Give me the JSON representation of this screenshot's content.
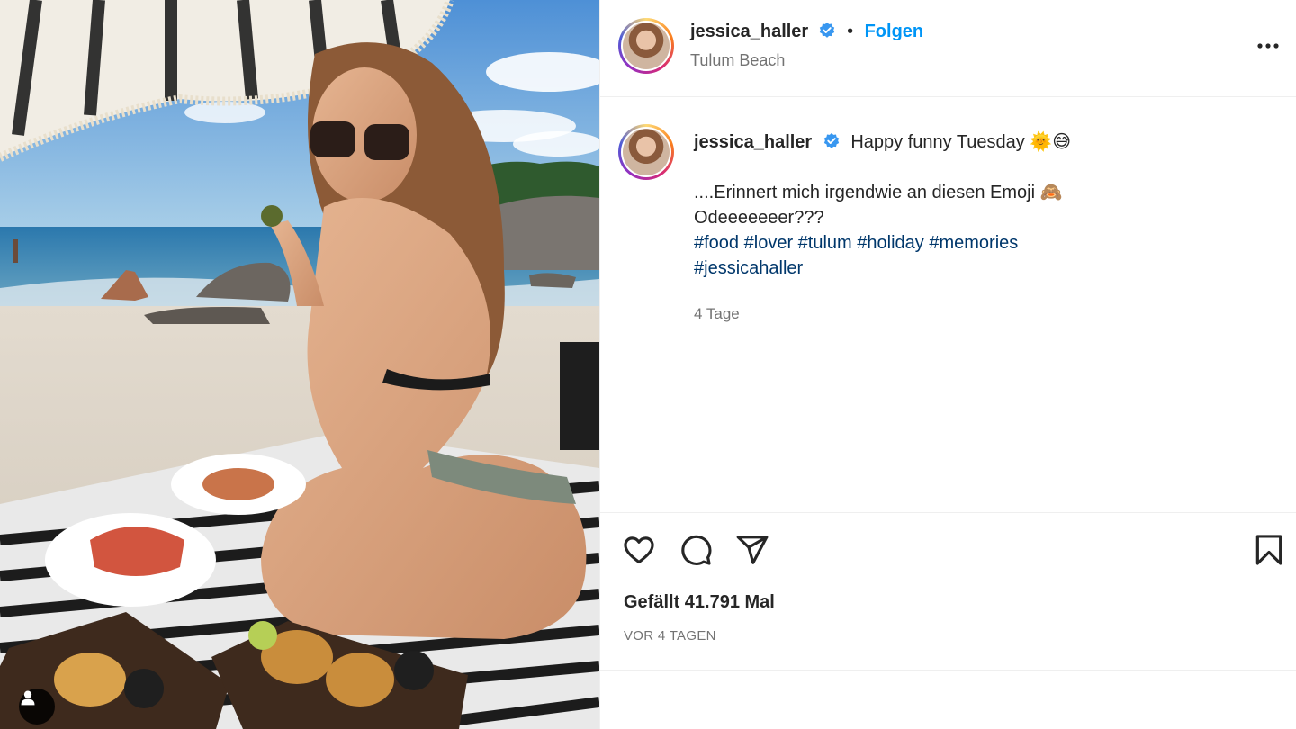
{
  "post": {
    "author": {
      "username": "jessica_haller",
      "verified": true,
      "location": "Tulum Beach"
    },
    "follow_label": "Folgen",
    "separator": "•",
    "caption": {
      "username": "jessica_haller",
      "first_line": "Happy funny Tuesday 🌞😅",
      "body_line_1": "....Erinnert mich irgendwie an diesen Emoji 🙈",
      "body_line_2": "Odeeeeeeer???",
      "hashtags": [
        "#food",
        "#lover",
        "#tulum",
        "#holiday",
        "#memories",
        "#jessicahaller"
      ],
      "age": "4 Tage"
    },
    "likes_text": "Gefällt 41.791 Mal",
    "posted_time": "VOR 4 TAGEN"
  },
  "icons": {
    "more": "more-options-icon",
    "like": "heart-icon",
    "comment": "comment-icon",
    "share": "share-icon",
    "save": "bookmark-icon",
    "user_tag": "user-tag-icon",
    "verified": "verified-badge-icon"
  },
  "colors": {
    "follow": "#0095f6",
    "hashtag": "#00376b",
    "verified": "#3897f0",
    "text": "#262626",
    "muted": "#737373",
    "border": "#efefef"
  }
}
